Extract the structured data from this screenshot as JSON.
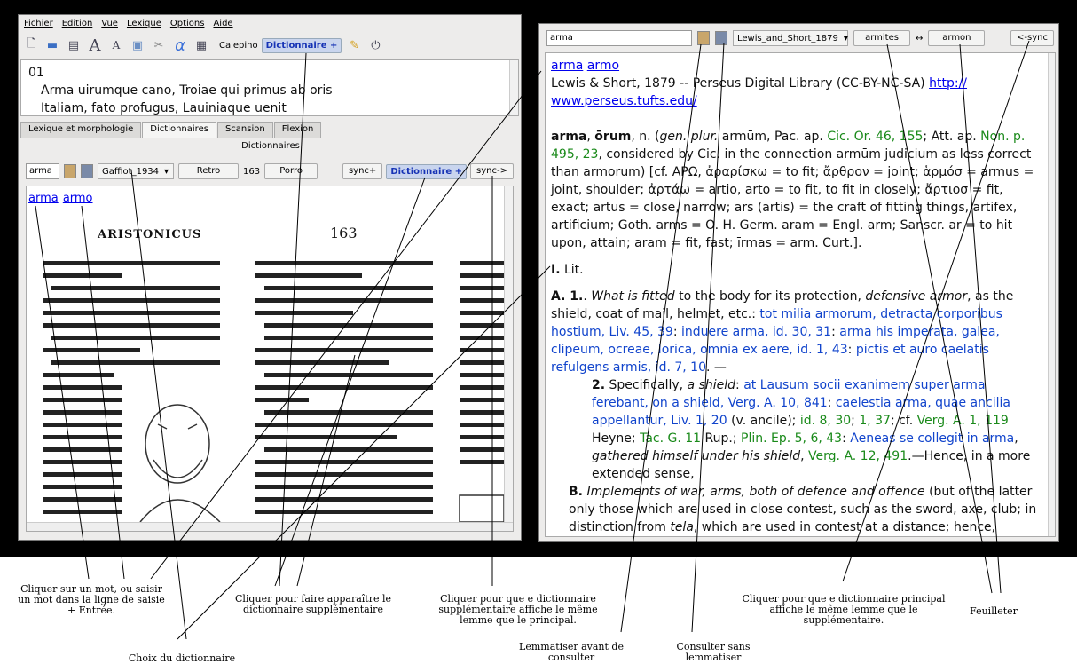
{
  "left_window": {
    "menu": [
      "Fichier",
      "Edition",
      "Vue",
      "Lexique",
      "Options",
      "Aide"
    ],
    "toolbar": {
      "calepino": "Calepino",
      "dict_button": "Dictionnaire +"
    },
    "text": {
      "line1": "01",
      "line2": "Arma uirumque cano, Troiae qui primus ab oris",
      "line3": "Italiam, fato profugus, Lauiniaque uenit"
    },
    "tabs": [
      "Lexique et morphologie",
      "Dictionnaires",
      "Scansion",
      "Flexion"
    ],
    "pane_title": "Dictionnaires",
    "search_value": "arma",
    "dict_combo": "Gaffiot_1934",
    "retro": "Retro",
    "page": "163",
    "page_word": "Porro",
    "sync_plus": "sync+",
    "dict_plus": "Dictionnaire +",
    "sync_arrow": "sync->",
    "links": [
      "arma",
      "armo"
    ],
    "scan": {
      "header_left": "ARISTONICUS",
      "header_page": "163"
    }
  },
  "right_window": {
    "search_value": "arma",
    "dict_combo": "Lewis_and_Short_1879",
    "prev_word": "armites",
    "arrow": "↔",
    "next_word": "armon",
    "sync_back": "<-sync",
    "links": [
      "arma",
      "armo"
    ],
    "source": "Lewis & Short, 1879 -- Perseus Digital Library (CC-BY-NC-SA) ",
    "url1": "http://",
    "url2": "www.perseus.tufts.edu/"
  },
  "captions": {
    "c1": "Cliquer sur un mot, ou saisir un mot dans la ligne de saisie + Entrée.",
    "c2": "Cliquer pour faire apparaître le dictionnaire supplémentaire",
    "c3": "Cliquer pour que e dictionnaire supplémentaire affiche le même lemme que le principal.",
    "c4": "Choix du dictionnaire",
    "c5": "Lemmatiser avant de consulter",
    "c6": "Consulter sans lemmatiser",
    "c7": "Cliquer pour que e dictionnaire principal affiche le même lemme que le supplémentaire.",
    "c8": "Feuilleter"
  }
}
